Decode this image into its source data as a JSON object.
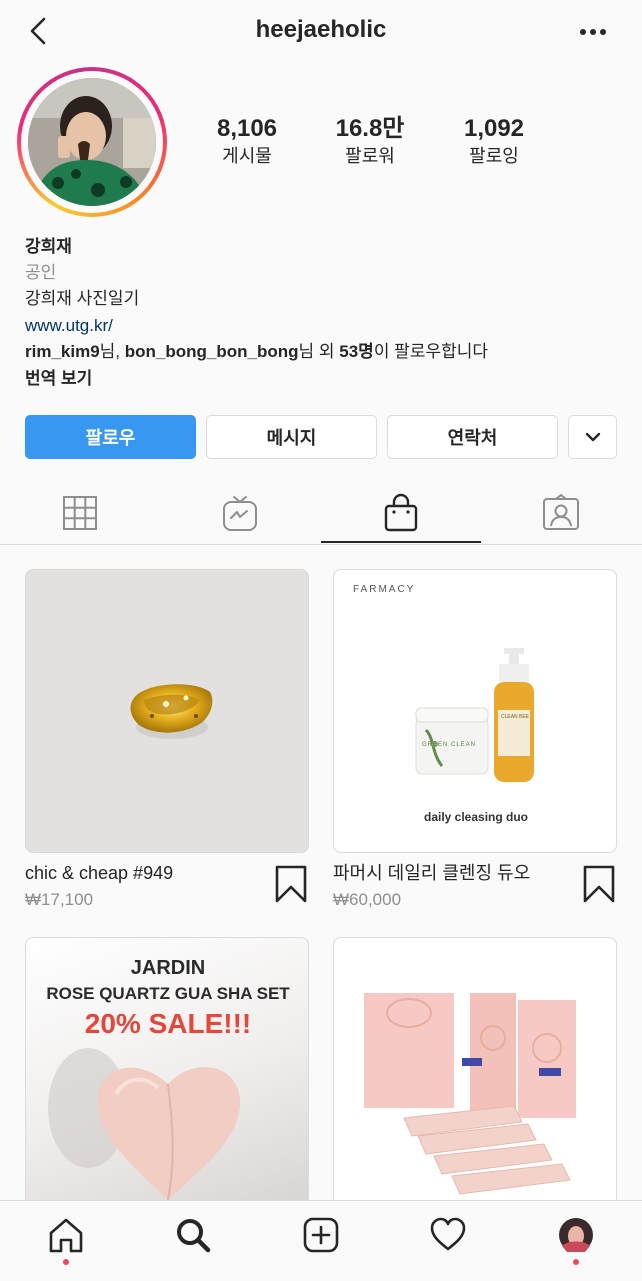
{
  "header": {
    "username": "heejaeholic"
  },
  "stats": [
    {
      "value": "8,106",
      "label": "게시물"
    },
    {
      "value": "16.8만",
      "label": "팔로워"
    },
    {
      "value": "1,092",
      "label": "팔로잉"
    }
  ],
  "bio": {
    "name": "강희재",
    "category": "공인",
    "description": "강희재 사진일기",
    "url": "www.utg.kr/",
    "followed_by": {
      "user1": "rim_kim9",
      "sep1": "님, ",
      "user2": "bon_bong_bon_bong",
      "sep2": "님 외 ",
      "count": "53명",
      "suffix": "이 팔로우합니다"
    },
    "translate": "번역 보기"
  },
  "buttons": {
    "follow": "팔로우",
    "message": "메시지",
    "contact": "연락처"
  },
  "tabs": [
    "grid-tab",
    "igtv-tab",
    "shop-tab",
    "tagged-tab"
  ],
  "products": [
    {
      "name": "chic & cheap #949",
      "price": "₩17,100"
    },
    {
      "name": "파머시 데일리 클렌징 듀오",
      "price": "₩60,000",
      "image_text": {
        "brand": "FARMACY",
        "jar": "GREEN CLEAN",
        "bottle": "CLEAN BEE",
        "caption": "daily cleasing duo"
      }
    },
    {
      "name": "",
      "price": "",
      "image_text": {
        "line1": "JARDIN",
        "line2": "ROSE QUARTZ GUA SHA SET",
        "line3": "20% SALE!!!"
      }
    },
    {
      "name": "",
      "price": ""
    }
  ],
  "colors": {
    "accent": "#3897f0",
    "link": "#00376b",
    "muted": "#8e8e8e",
    "sale": "#e5473a",
    "notification": "#ed4956"
  }
}
